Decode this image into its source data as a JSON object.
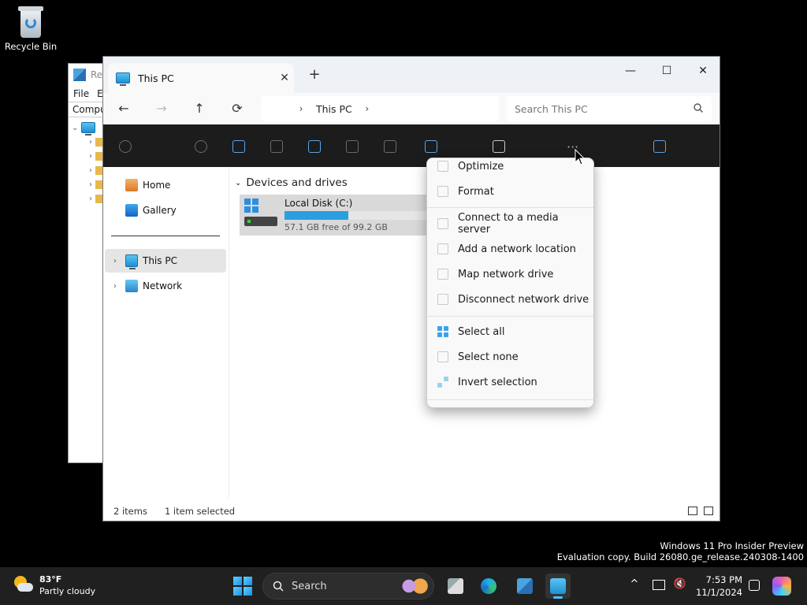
{
  "desktop": {
    "recycle_bin_label": "Recycle Bin"
  },
  "background_window": {
    "title": "Re",
    "menu": [
      "File",
      "E"
    ],
    "address": "Compu"
  },
  "explorer": {
    "tab_title": "This PC",
    "new_tab": "+",
    "close_tab": "✕",
    "minimize": "—",
    "maximize": "☐",
    "close": "✕",
    "nav": {
      "back": "←",
      "forward": "→",
      "up": "↑",
      "refresh": "⟳"
    },
    "breadcrumb": [
      "This PC"
    ],
    "search_placeholder": "Search This PC",
    "sidebar": [
      {
        "label": "Home",
        "icon": "home-icon"
      },
      {
        "label": "Gallery",
        "icon": "gallery-icon"
      },
      {
        "label": "This PC",
        "icon": "computer-icon",
        "selected": true,
        "expandable": true
      },
      {
        "label": "Network",
        "icon": "network-icon",
        "expandable": true
      }
    ],
    "group_header": "Devices and drives",
    "drive": {
      "name": "Local Disk (C:)",
      "free_text": "57.1 GB free of 99.2 GB",
      "used_fraction": 0.424
    },
    "status": {
      "items": "2 items",
      "selected": "1 item selected"
    }
  },
  "context_menu": {
    "items": [
      {
        "label": "Optimize",
        "icon": "optimize-icon"
      },
      {
        "label": "Format",
        "icon": "format-icon"
      },
      {
        "label": "Connect to a media server",
        "icon": "media-server-icon"
      },
      {
        "label": "Add a network location",
        "icon": "network-location-icon"
      },
      {
        "label": "Map network drive",
        "icon": "map-drive-icon"
      },
      {
        "label": "Disconnect network drive",
        "icon": "disconnect-drive-icon"
      },
      {
        "label": "Select all",
        "icon": "select-all-icon"
      },
      {
        "label": "Select none",
        "icon": "select-none-icon"
      },
      {
        "label": "Invert selection",
        "icon": "invert-selection-icon"
      }
    ]
  },
  "watermark": {
    "line1": "Windows 11 Pro Insider Preview",
    "line2": "Evaluation copy. Build 26080.ge_release.240308-1400"
  },
  "taskbar": {
    "weather_temp": "83°F",
    "weather_desc": "Partly cloudy",
    "search_label": "Search",
    "time": "7:53 PM",
    "date": "11/1/2024",
    "tray_chevron": "^"
  },
  "colors": {
    "accent": "#2a9fe0",
    "command_bar": "#1c1c1c",
    "taskbar": "#202020"
  }
}
